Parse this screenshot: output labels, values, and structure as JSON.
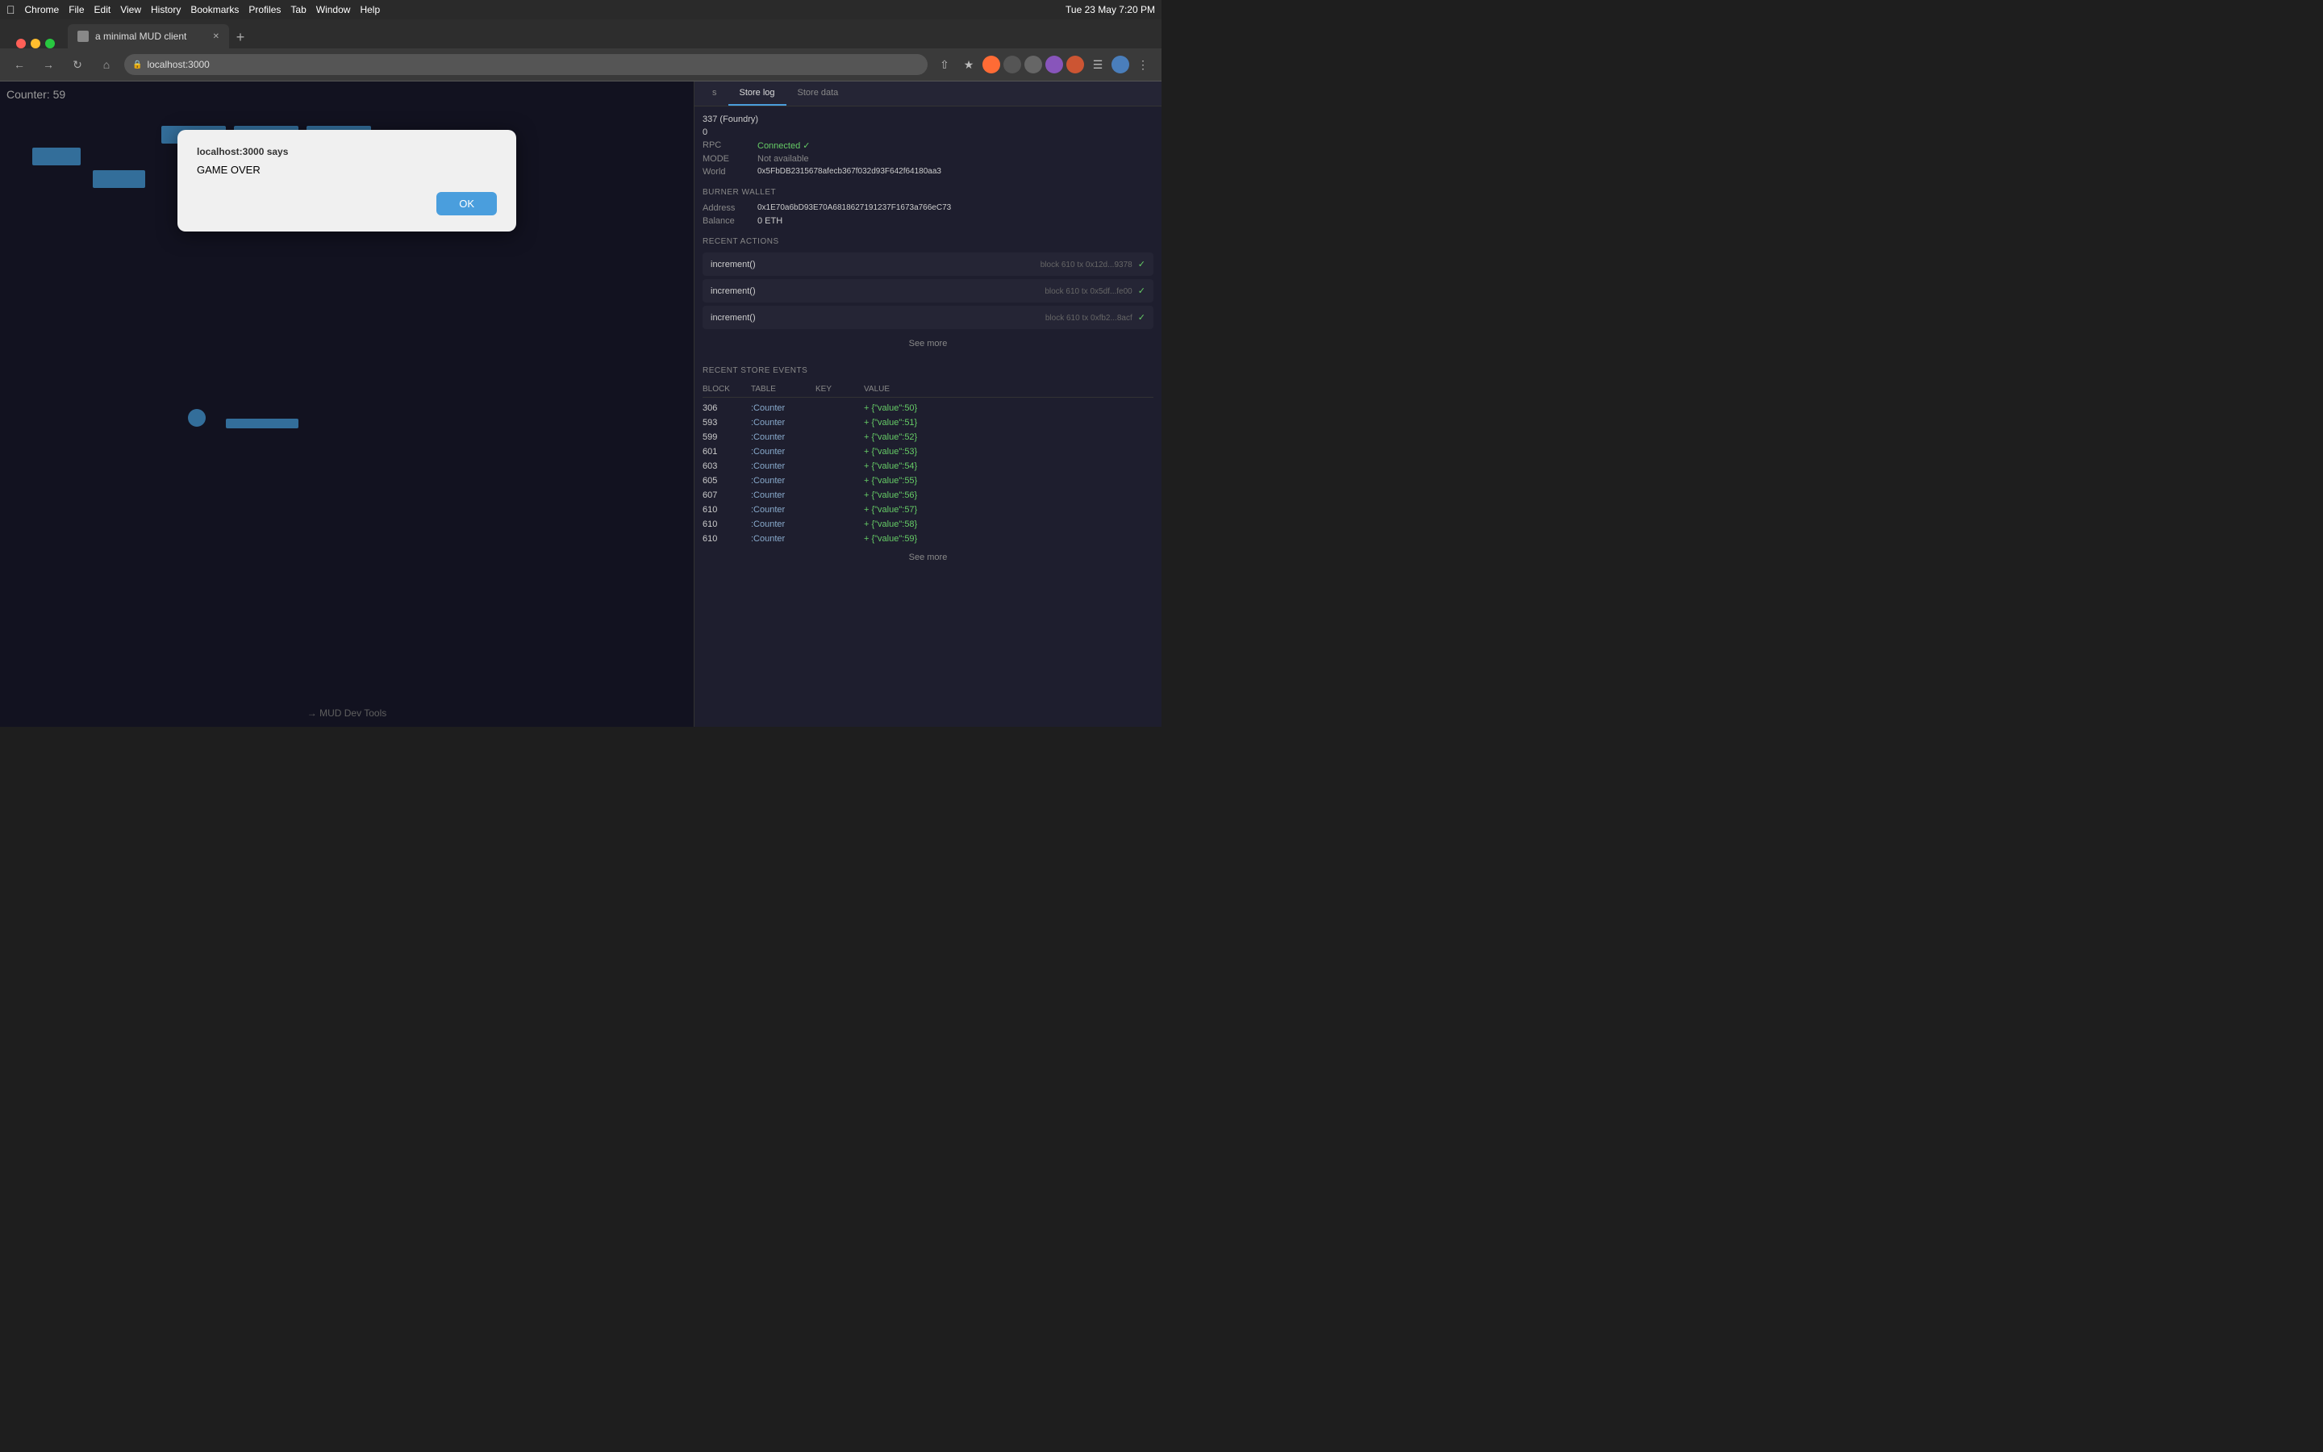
{
  "menubar": {
    "apple": "⌘",
    "items": [
      "Chrome",
      "File",
      "Edit",
      "View",
      "History",
      "Bookmarks",
      "Profiles",
      "Tab",
      "Window",
      "Help"
    ],
    "right": "Tue 23 May  7:20 PM"
  },
  "browser": {
    "tab_title": "a minimal MUD client",
    "url": "localhost:3000",
    "new_tab_label": "+"
  },
  "dialog": {
    "title": "localhost:3000 says",
    "message": "GAME OVER",
    "ok_label": "OK"
  },
  "game": {
    "counter_label": "Counter: 59",
    "mud_tools_label": "→ MUD Dev Tools"
  },
  "devpanel": {
    "tabs": [
      "s",
      "Store log",
      "Store data"
    ],
    "active_tab": "Store log",
    "network": {
      "label_block": "",
      "value_block": "337 (Foundry)",
      "label_avg": "",
      "value_avg": "0",
      "label_rpc": "RPC",
      "value_rpc": "Connected ✓",
      "label_mode": "MODE",
      "value_mode": "Not available",
      "label_world": "World",
      "value_world": "0x5FbDB2315678afecb367f032d93F642f64180aa3"
    },
    "burner_wallet": {
      "section_title": "BURNER WALLET",
      "label_address": "Address",
      "value_address": "0x1E70a6bD93E70A6818627191237F1673a766eC73",
      "label_balance": "Balance",
      "value_balance": "0 ETH"
    },
    "recent_actions": {
      "section_title": "RECENT ACTIONS",
      "actions": [
        {
          "name": "increment()",
          "meta": "block 610  tx  0x12d...9378",
          "check": "✓"
        },
        {
          "name": "increment()",
          "meta": "block 610  tx  0x5df...fe00",
          "check": "✓"
        },
        {
          "name": "increment()",
          "meta": "block 610  tx  0xfb2...8acf",
          "check": "✓"
        }
      ],
      "see_more_label": "See more"
    },
    "recent_store_events": {
      "section_title": "RECENT STORE EVENTS",
      "columns": [
        "BLOCK",
        "TABLE",
        "KEY",
        "VALUE"
      ],
      "rows": [
        {
          "block": "306",
          "table": ":Counter",
          "key": "",
          "value": "+ {\"value\":50}"
        },
        {
          "block": "593",
          "table": ":Counter",
          "key": "",
          "value": "+ {\"value\":51}"
        },
        {
          "block": "599",
          "table": ":Counter",
          "key": "",
          "value": "+ {\"value\":52}"
        },
        {
          "block": "601",
          "table": ":Counter",
          "key": "",
          "value": "+ {\"value\":53}"
        },
        {
          "block": "603",
          "table": ":Counter",
          "key": "",
          "value": "+ {\"value\":54}"
        },
        {
          "block": "605",
          "table": ":Counter",
          "key": "",
          "value": "+ {\"value\":55}"
        },
        {
          "block": "607",
          "table": ":Counter",
          "key": "",
          "value": "+ {\"value\":56}"
        },
        {
          "block": "610",
          "table": ":Counter",
          "key": "",
          "value": "+ {\"value\":57}"
        },
        {
          "block": "610",
          "table": ":Counter",
          "key": "",
          "value": "+ {\"value\":58}"
        },
        {
          "block": "610",
          "table": ":Counter",
          "key": "",
          "value": "+ {\"value\":59}"
        }
      ],
      "see_more_label": "See more"
    }
  }
}
